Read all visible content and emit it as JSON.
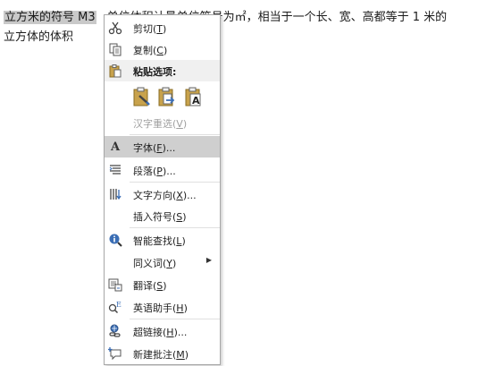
{
  "document": {
    "line1_selected": "立方米的符号 M3",
    "line1_rest": "单位体积计量单位符号为㎡，相当于一个长、宽、高都等于 1 米的",
    "line2": "立方体的体积"
  },
  "context_menu": {
    "cut": {
      "label": "剪切(",
      "key": "T",
      "tail": ")"
    },
    "copy": {
      "label": "复制(",
      "key": "C",
      "tail": ")"
    },
    "paste_header": "粘贴选项:",
    "hanzi_reselect": {
      "label": "汉字重选(",
      "key": "V",
      "tail": ")"
    },
    "font": {
      "label": "字体(",
      "key": "F",
      "tail": ")..."
    },
    "paragraph": {
      "label": "段落(",
      "key": "P",
      "tail": ")..."
    },
    "text_direction": {
      "label": "文字方向(",
      "key": "X",
      "tail": ")..."
    },
    "insert_symbol": {
      "label": "插入符号(",
      "key": "S",
      "tail": ")"
    },
    "smart_lookup": {
      "label": "智能查找(",
      "key": "L",
      "tail": ")"
    },
    "synonyms": {
      "label": "同义词(",
      "key": "Y",
      "tail": ")"
    },
    "translate": {
      "label": "翻译(",
      "key": "S",
      "tail": ")"
    },
    "english_assistant": {
      "label": "英语助手(",
      "key": "H",
      "tail": ")"
    },
    "hyperlink": {
      "label": "超链接(",
      "key": "H",
      "tail": ")..."
    },
    "new_comment": {
      "label": "新建批注(",
      "key": "M",
      "tail": ")"
    }
  },
  "icons": {
    "cut": "scissors-icon",
    "copy": "copy-icon",
    "paste": "clipboard-icon",
    "font": "font-a-icon",
    "paragraph": "paragraph-icon",
    "text_direction": "text-direction-icon",
    "smart_lookup": "smart-lookup-icon",
    "translate": "translate-icon",
    "english_assistant": "english-assistant-icon",
    "hyperlink": "hyperlink-icon",
    "new_comment": "comment-icon"
  },
  "colors": {
    "highlight": "#cfcfcf",
    "disabled_text": "#a0a0a0",
    "icon_blue": "#3b6eb5",
    "clipboard_tan": "#c8a24c"
  }
}
